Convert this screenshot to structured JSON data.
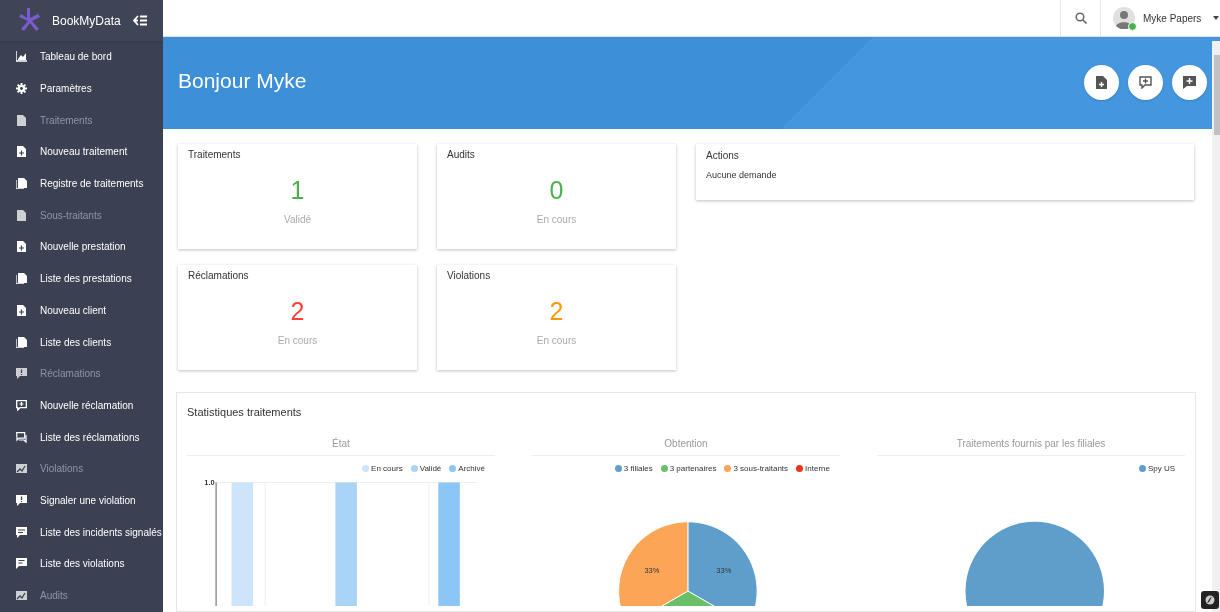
{
  "brand": {
    "name": "BookMyData"
  },
  "sidebar": {
    "items": [
      {
        "kind": "link",
        "label": "Tableau de bord"
      },
      {
        "kind": "link",
        "label": "Paramètres"
      },
      {
        "kind": "section",
        "label": "Traitements"
      },
      {
        "kind": "link",
        "label": "Nouveau traitement"
      },
      {
        "kind": "link",
        "label": "Registre de traitements"
      },
      {
        "kind": "section",
        "label": "Sous-traitants"
      },
      {
        "kind": "link",
        "label": "Nouvelle prestation"
      },
      {
        "kind": "link",
        "label": "Liste des prestations"
      },
      {
        "kind": "link",
        "label": "Nouveau client"
      },
      {
        "kind": "link",
        "label": "Liste des clients"
      },
      {
        "kind": "section",
        "label": "Réclamations"
      },
      {
        "kind": "link",
        "label": "Nouvelle réclamation"
      },
      {
        "kind": "link",
        "label": "Liste des réclamations"
      },
      {
        "kind": "section",
        "label": "Violations"
      },
      {
        "kind": "link",
        "label": "Signaler une violation"
      },
      {
        "kind": "link",
        "label": "Liste des incidents signalés"
      },
      {
        "kind": "link",
        "label": "Liste des violations"
      },
      {
        "kind": "section",
        "label": "Audits"
      }
    ]
  },
  "user": {
    "name": "Myke Papers",
    "online": true
  },
  "header": {
    "greeting": "Bonjour Myke"
  },
  "cards": [
    {
      "title": "Traitements",
      "value": "1",
      "caption": "Validé",
      "color": "#4caf50"
    },
    {
      "title": "Audits",
      "value": "0",
      "caption": "En cours",
      "color": "#4caf50"
    },
    {
      "title": "Réclamations",
      "value": "2",
      "caption": "En cours",
      "color": "#f44336"
    },
    {
      "title": "Violations",
      "value": "2",
      "caption": "En cours",
      "color": "#ff9800"
    }
  ],
  "actions": {
    "title": "Actions",
    "text": "Aucune demande"
  },
  "stats": {
    "title": "Statistiques traitements",
    "charts": [
      {
        "kind": "bars",
        "title": "État",
        "tick": "1.0",
        "legend": [
          {
            "label": "En cours",
            "color": "#cce5fb"
          },
          {
            "label": "Validé",
            "color": "#a9d4f8"
          },
          {
            "label": "Archivé",
            "color": "#8cc6f6"
          }
        ]
      },
      {
        "kind": "pie",
        "chart_data": {
          "type": "pie",
          "title": "Obtention",
          "legend": "top-right",
          "categories": [
            "3 filiales",
            "3 partenaires",
            "3 sous-traitants",
            "Interne"
          ],
          "values": [
            33,
            33,
            33,
            0
          ],
          "value_labels": [
            "33%",
            null,
            "33%",
            null
          ]
        }
      },
      {
        "kind": "pie",
        "chart_data": {
          "type": "pie",
          "title": "Traitements fournis par les filiales",
          "legend": "top-right",
          "categories": [
            "Spy US"
          ],
          "values": [
            100
          ]
        }
      }
    ]
  }
}
